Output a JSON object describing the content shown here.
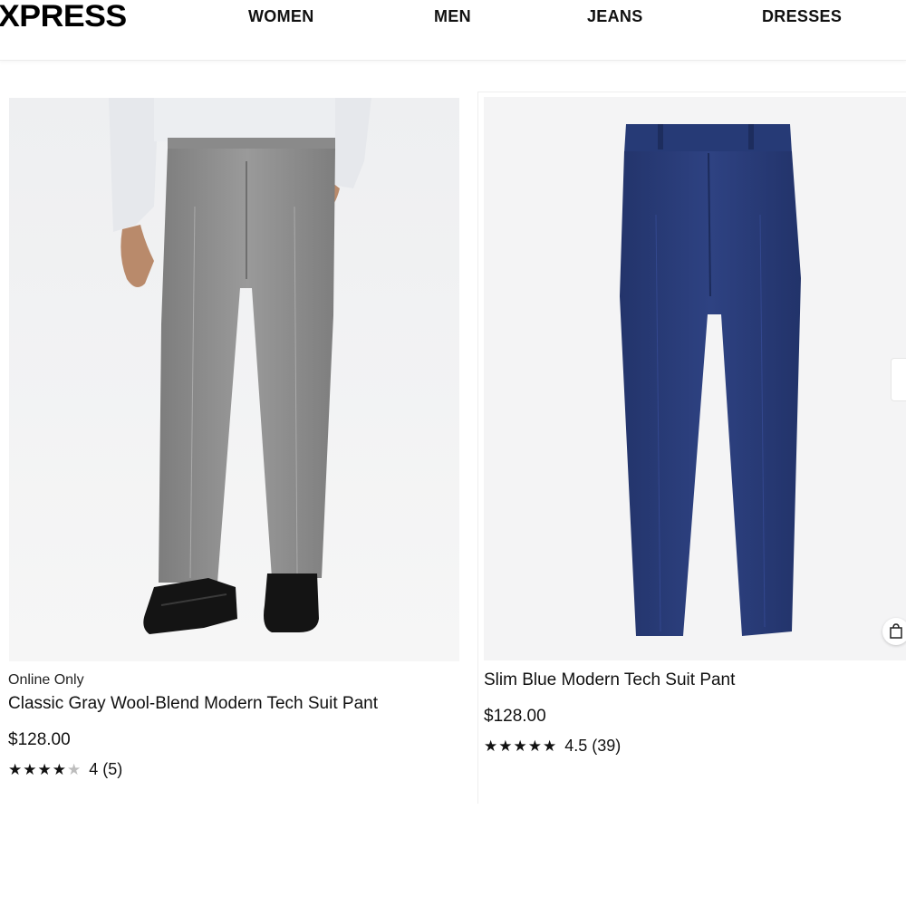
{
  "header": {
    "logo": "XPRESS",
    "nav": [
      "WOMEN",
      "MEN",
      "JEANS",
      "DRESSES"
    ]
  },
  "products": [
    {
      "badge": "Online Only",
      "title": "Classic Gray Wool-Blend Modern Tech Suit Pant",
      "price": "$128.00",
      "stars_filled": 4,
      "stars_total": 5,
      "rating_text": "4 (5)",
      "image_icon": "gray-suit-pant-image"
    },
    {
      "title": "Slim Blue Modern Tech Suit Pant",
      "price": "$128.00",
      "stars_filled": 5,
      "stars_total": 5,
      "rating_text": "4.5 (39)",
      "image_icon": "blue-suit-pant-image"
    }
  ],
  "colors": {
    "gray_pant": "#8e8e8e",
    "blue_pant": "#2c3e7a",
    "shirt": "#e8eaee",
    "shoe": "#1a1a1a"
  }
}
